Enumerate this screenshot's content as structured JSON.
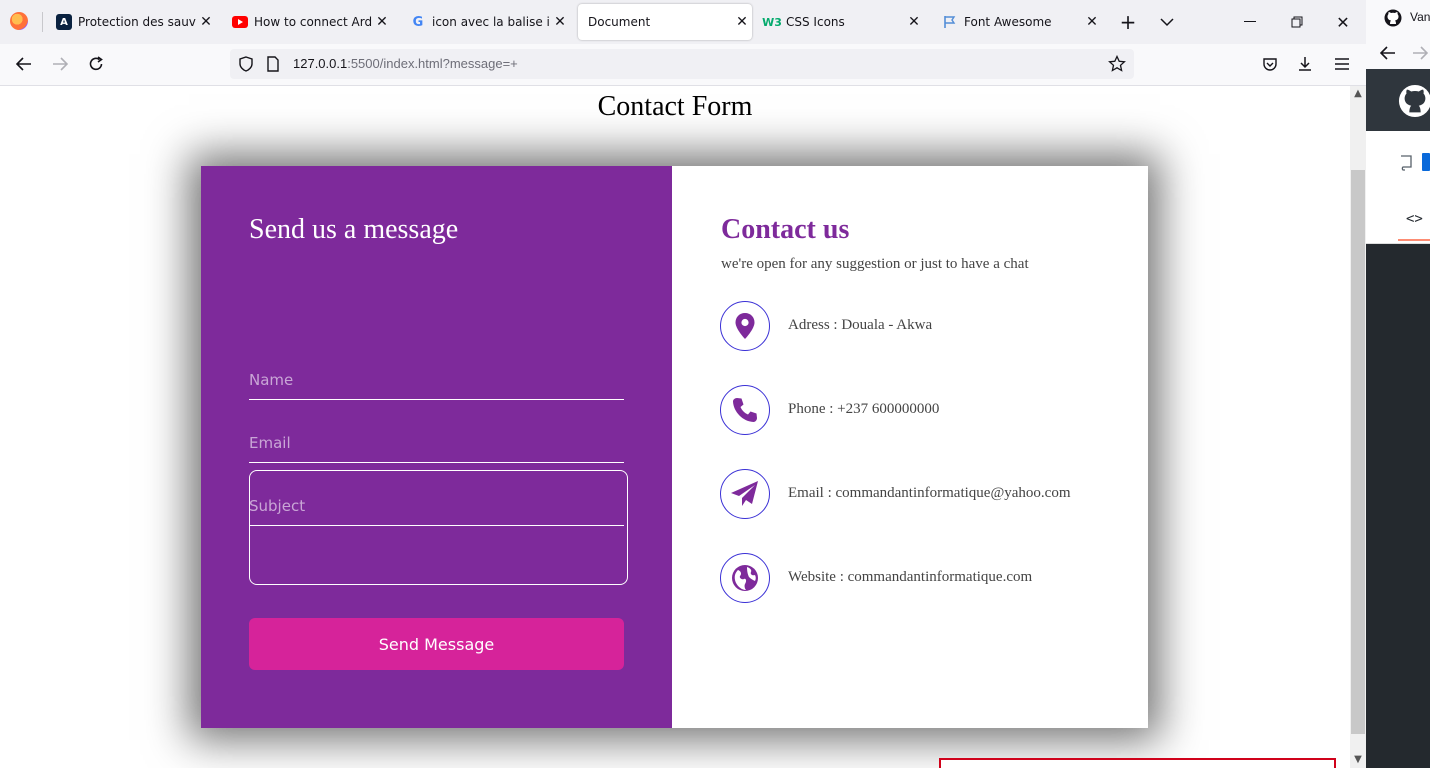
{
  "browser": {
    "tabs": [
      {
        "label": "Protection des sauvega",
        "favicon": "A"
      },
      {
        "label": "How to connect Arduin",
        "favicon": "youtube-icon"
      },
      {
        "label": "icon avec la balise i - R",
        "favicon": "google-icon"
      },
      {
        "label": "Document",
        "favicon": ""
      },
      {
        "label": "CSS Icons",
        "favicon": "W3"
      },
      {
        "label": "Font Awesome",
        "favicon": "flag-icon"
      }
    ],
    "active_tab": 3,
    "url_host": "127.0.0.1",
    "url_rest": ":5500/index.html?message=+",
    "side_tab_label": "Van"
  },
  "page": {
    "title": "Contact Form"
  },
  "form": {
    "title": "Send us a message",
    "name_placeholder": "Name",
    "email_placeholder": "Email",
    "subject_placeholder": "Subject",
    "message_value": "",
    "send_label": "Send Message"
  },
  "contact": {
    "title": "Contact us",
    "subtitle": "we're open for any suggestion or just to have a chat",
    "items": [
      {
        "icon": "location-pin-icon",
        "text": "Adress : Douala - Akwa"
      },
      {
        "icon": "phone-icon",
        "text": "Phone : +237 600000000"
      },
      {
        "icon": "paper-plane-icon",
        "text": "Email : commandantinformatique@yahoo.com"
      },
      {
        "icon": "globe-icon",
        "text": "Website : commandantinformatique.com"
      }
    ]
  },
  "colors": {
    "primary_purple": "#7e2a9b",
    "button_pink": "#d6239a",
    "icon_border": "#3b31d6"
  }
}
